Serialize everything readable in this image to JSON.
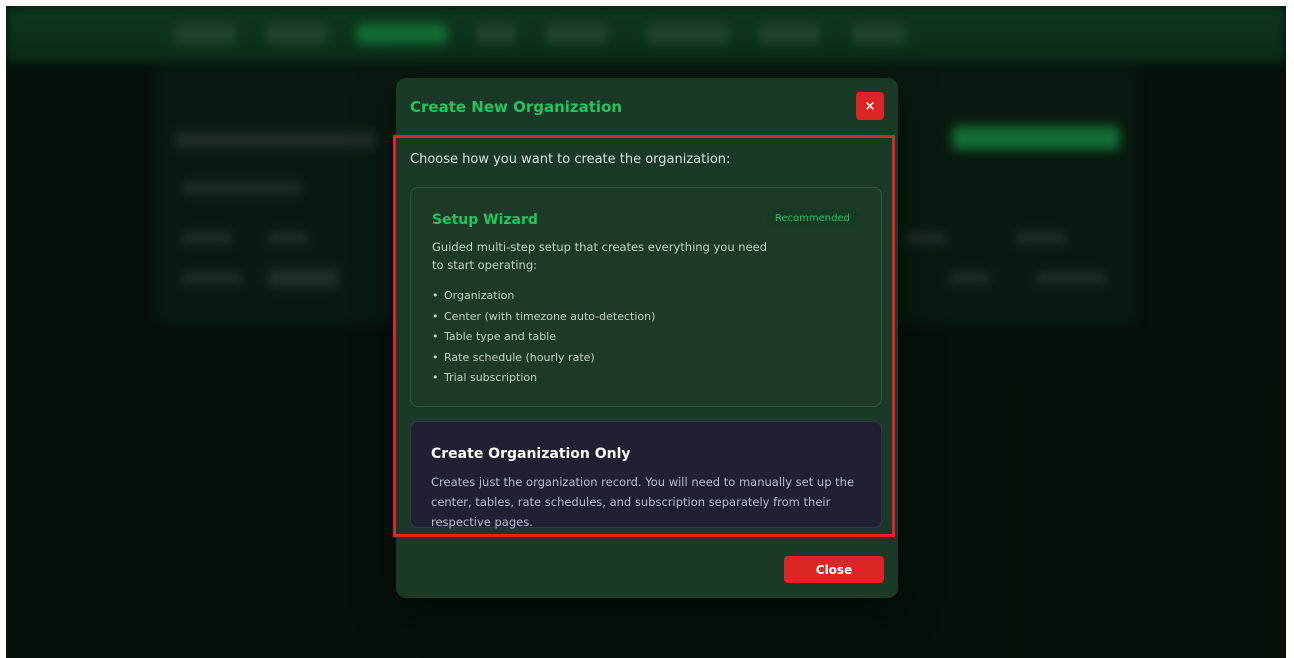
{
  "modal": {
    "title": "Create New Organization",
    "close_x_label": "×",
    "intro": "Choose how you want to create the organization:",
    "wizard": {
      "title": "Setup Wizard",
      "badge": "Recommended",
      "description": "Guided multi-step setup that creates everything you need to start operating:",
      "items": [
        "Organization",
        "Center (with timezone auto-detection)",
        "Table type and table",
        "Rate schedule (hourly rate)",
        "Trial subscription"
      ]
    },
    "org_only": {
      "title": "Create Organization Only",
      "description": "Creates just the organization record. You will need to manually set up the center, tables, rate schedules, and subscription separately from their respective pages."
    },
    "close_button": "Close"
  },
  "colors": {
    "accent": "#22c55e",
    "danger": "#dc2626",
    "modal_bg": "#1a3a27",
    "nav_bg": "#166534"
  }
}
